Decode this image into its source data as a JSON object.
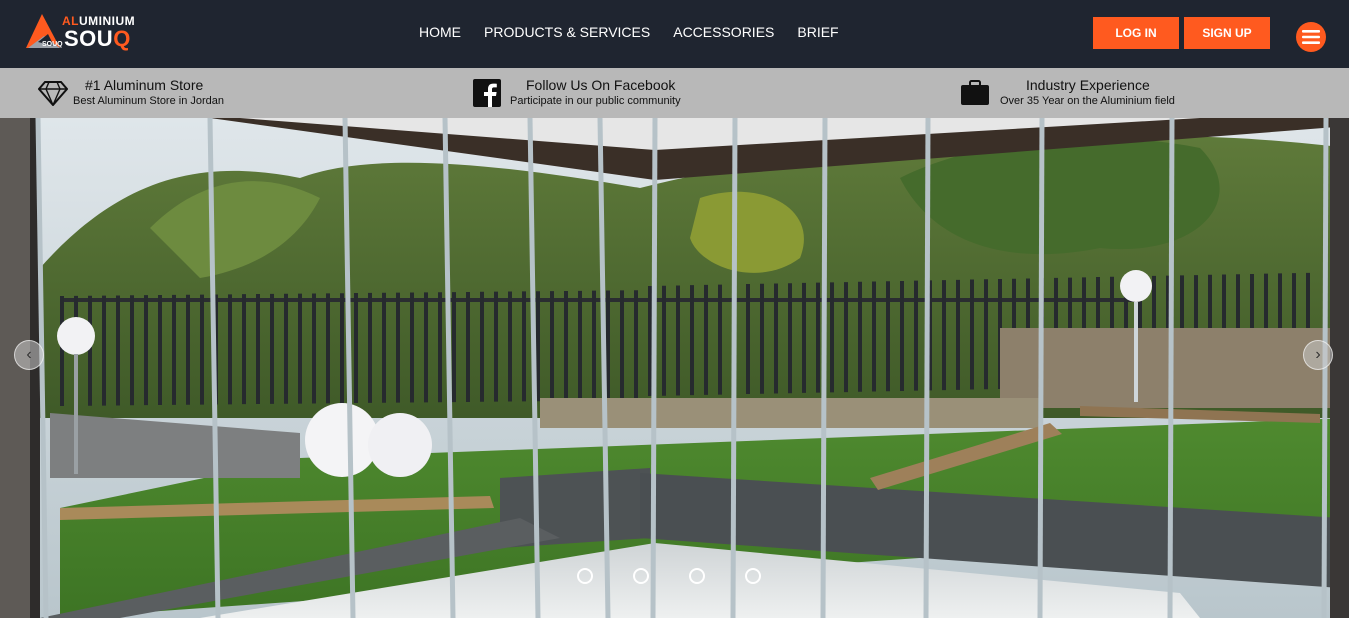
{
  "brand": {
    "logo_top_prefix": "AL",
    "logo_top_rest": "UMINIUM",
    "logo_small": "SOUQ",
    "logo_big_main": "SOU",
    "logo_big_accent": "Q"
  },
  "nav": {
    "items": [
      {
        "label": "HOME"
      },
      {
        "label": "PRODUCTS & SERVICES"
      },
      {
        "label": "ACCESSORIES"
      },
      {
        "label": "BRIEF"
      }
    ]
  },
  "auth": {
    "login_label": "LOG IN",
    "signup_label": "SIGN UP"
  },
  "menu": {
    "icon": "hamburger-icon"
  },
  "features": [
    {
      "icon": "diamond-icon",
      "title": "#1 Aluminum Store",
      "subtitle": "Best Aluminum Store in Jordan"
    },
    {
      "icon": "facebook-icon",
      "title": "Follow Us On Facebook",
      "subtitle": "Participate in our public community"
    },
    {
      "icon": "briefcase-icon",
      "title": "Industry Experience",
      "subtitle": "Over 35 Year on the Aluminium field"
    }
  ],
  "slider": {
    "prev_icon": "chevron-left-icon",
    "next_icon": "chevron-right-icon",
    "prev_glyph": "‹",
    "next_glyph": "›",
    "slide_count": 4,
    "active_slide": 1
  },
  "colors": {
    "accent": "#ff5a1f",
    "navbar": "#1f2530",
    "strip": "#b8b8b8"
  }
}
